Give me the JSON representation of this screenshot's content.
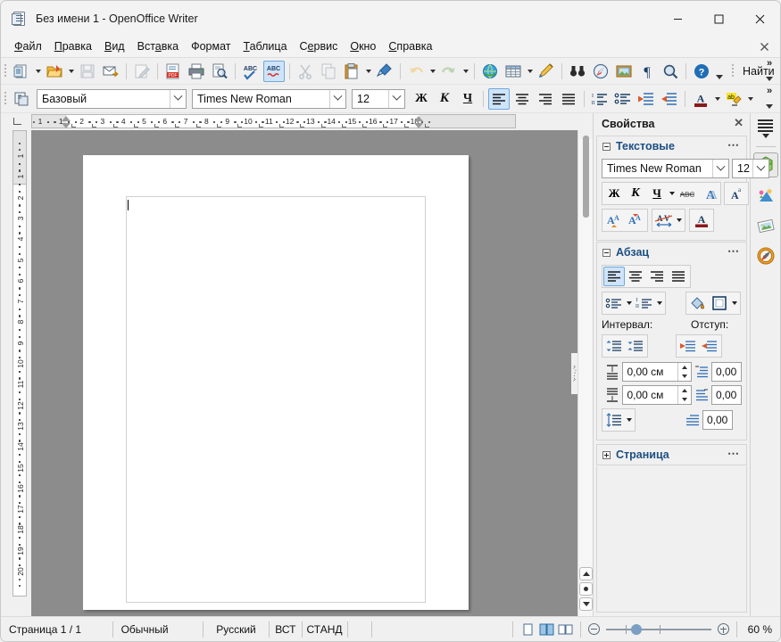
{
  "window": {
    "title": "Без имени 1 - OpenOffice Writer",
    "icon": "writer-document-icon",
    "controls": {
      "minimize": "minimize-icon",
      "maximize": "maximize-icon",
      "close": "close-icon"
    }
  },
  "menubar": {
    "items": [
      {
        "label": "Файл",
        "accel": "Ф"
      },
      {
        "label": "Правка",
        "accel": "П"
      },
      {
        "label": "Вид",
        "accel": "В"
      },
      {
        "label": "Вставка",
        "accel": "а"
      },
      {
        "label": "Формат",
        "accel": ""
      },
      {
        "label": "Таблица",
        "accel": "Т"
      },
      {
        "label": "Сервис",
        "accel": "е"
      },
      {
        "label": "Окно",
        "accel": "О"
      },
      {
        "label": "Справка",
        "accel": "С"
      }
    ],
    "close_document": "close-document-icon"
  },
  "standard_toolbar": {
    "buttons": [
      {
        "name": "new-document",
        "icon": "new-doc-icon",
        "dropdown": true,
        "enabled": true
      },
      {
        "name": "open-document",
        "icon": "open-folder-icon",
        "dropdown": true,
        "enabled": true
      },
      {
        "name": "save-document",
        "icon": "save-floppy-icon",
        "dropdown": false,
        "enabled": false
      },
      {
        "name": "email-document",
        "icon": "email-envelope-icon",
        "dropdown": false,
        "enabled": true
      },
      {
        "name": "edit-file",
        "icon": "edit-pencil-page-icon",
        "dropdown": false,
        "enabled": false
      },
      {
        "name": "export-pdf",
        "icon": "pdf-export-icon",
        "dropdown": false,
        "enabled": true
      },
      {
        "name": "print-document",
        "icon": "printer-icon",
        "dropdown": false,
        "enabled": true
      },
      {
        "name": "print-preview",
        "icon": "print-preview-magnifier-icon",
        "dropdown": false,
        "enabled": true
      },
      {
        "name": "spelling-check",
        "icon": "abc-spellcheck-icon",
        "dropdown": false,
        "enabled": true
      },
      {
        "name": "autospellcheck",
        "icon": "abc-autospell-icon",
        "dropdown": false,
        "enabled": true,
        "active": true
      },
      {
        "name": "cut",
        "icon": "scissors-icon",
        "dropdown": false,
        "enabled": false
      },
      {
        "name": "copy",
        "icon": "copy-pages-icon",
        "dropdown": false,
        "enabled": false
      },
      {
        "name": "paste",
        "icon": "clipboard-paste-icon",
        "dropdown": true,
        "enabled": true
      },
      {
        "name": "clone-formatting",
        "icon": "paintbrush-icon",
        "dropdown": false,
        "enabled": true
      },
      {
        "name": "undo",
        "icon": "undo-arrow-icon",
        "dropdown": true,
        "enabled": false
      },
      {
        "name": "redo",
        "icon": "redo-arrow-icon",
        "dropdown": true,
        "enabled": false
      },
      {
        "name": "hyperlink",
        "icon": "globe-hyperlink-icon",
        "dropdown": false,
        "enabled": true
      },
      {
        "name": "insert-table",
        "icon": "table-grid-icon",
        "dropdown": true,
        "enabled": true
      },
      {
        "name": "show-draw-functions",
        "icon": "draw-pencil-icon",
        "dropdown": false,
        "enabled": true
      },
      {
        "name": "find-and-replace",
        "icon": "binoculars-icon",
        "dropdown": false,
        "enabled": true
      },
      {
        "name": "navigator",
        "icon": "compass-navigator-icon",
        "dropdown": false,
        "enabled": true
      },
      {
        "name": "gallery",
        "icon": "gallery-picture-icon",
        "dropdown": false,
        "enabled": true
      },
      {
        "name": "formatting-marks",
        "icon": "pilcrow-icon",
        "dropdown": false,
        "enabled": true
      },
      {
        "name": "zoom",
        "icon": "magnifier-zoom-icon",
        "dropdown": false,
        "enabled": true
      },
      {
        "name": "help",
        "icon": "help-question-icon",
        "dropdown": false,
        "enabled": true
      }
    ],
    "find_label": "Найти",
    "overflow": "toolbar-overflow-icon"
  },
  "format_toolbar": {
    "styles_icon": "apply-style-icon",
    "paragraph_style": "Базовый",
    "font_name": "Times New Roman",
    "font_size": "12",
    "bold_label": "Ж",
    "italic_label": "К",
    "underline_label": "Ч",
    "buttons": [
      {
        "name": "align-left",
        "icon": "align-left-icon",
        "active": true
      },
      {
        "name": "align-center",
        "icon": "align-center-icon",
        "active": false
      },
      {
        "name": "align-right",
        "icon": "align-right-icon",
        "active": false
      },
      {
        "name": "align-justified",
        "icon": "align-justify-icon",
        "active": false
      },
      {
        "name": "ordered-list",
        "icon": "numbered-list-icon",
        "active": false
      },
      {
        "name": "unordered-list",
        "icon": "bullet-list-icon",
        "active": false
      },
      {
        "name": "decrease-indent",
        "icon": "decrease-indent-icon",
        "active": false
      },
      {
        "name": "increase-indent",
        "icon": "increase-indent-icon",
        "active": false
      },
      {
        "name": "font-color",
        "icon": "font-color-a-icon",
        "active": false
      },
      {
        "name": "highlighting",
        "icon": "highlight-marker-icon",
        "active": false
      }
    ],
    "overflow": "toolbar-overflow-icon"
  },
  "rulers": {
    "horizontal": {
      "unit": "cm",
      "labels": [
        "1",
        "1",
        "2",
        "3",
        "4",
        "5",
        "6",
        "7",
        "8",
        "9",
        "10",
        "11",
        "12",
        "13",
        "14",
        "15",
        "16",
        "17",
        "18"
      ]
    },
    "vertical": {
      "unit": "cm",
      "labels": [
        "1",
        "1",
        "2",
        "3",
        "4",
        "5",
        "6",
        "7",
        "8",
        "9",
        "10",
        "11",
        "12",
        "13",
        "14",
        "15",
        "16",
        "17",
        "18",
        "19",
        "20"
      ]
    }
  },
  "document": {
    "page_background": "#ffffff",
    "canvas_background": "#8c8c8c",
    "text_frame_border": "#d0d0d0",
    "content": ""
  },
  "scrollbar": {
    "previous_page": "previous-page-icon",
    "navigation": "navigation-dot-icon",
    "next_page": "next-page-icon"
  },
  "sidebar": {
    "title": "Свойства",
    "close_icon": "close-icon",
    "panels": [
      {
        "id": "character",
        "title": "Текстовые",
        "expanded": true,
        "more_icon": "more-options-icon",
        "font_name": "Times New Roman",
        "font_size": "12",
        "bold_label": "Ж",
        "italic_label": "К",
        "underline_label": "Ч",
        "buttons": [
          {
            "name": "bold",
            "icon": "bold-icon"
          },
          {
            "name": "italic",
            "icon": "italic-icon"
          },
          {
            "name": "underline",
            "icon": "underline-icon"
          },
          {
            "name": "strikethrough",
            "icon": "strikethrough-abc-icon"
          },
          {
            "name": "shadow",
            "icon": "shadow-a-icon"
          },
          {
            "name": "superscript",
            "icon": "superscript-icon"
          },
          {
            "name": "increase-font-size",
            "icon": "grow-font-icon"
          },
          {
            "name": "decrease-font-size",
            "icon": "shrink-font-icon"
          },
          {
            "name": "character-spacing",
            "icon": "character-spacing-av-icon"
          },
          {
            "name": "font-color",
            "icon": "font-color-a-icon"
          }
        ]
      },
      {
        "id": "paragraph",
        "title": "Абзац",
        "expanded": true,
        "more_icon": "more-options-icon",
        "spacing_label": "Интервал:",
        "indent_label": "Отступ:",
        "align_buttons": [
          {
            "name": "align-left",
            "icon": "align-left-icon",
            "active": true
          },
          {
            "name": "align-center",
            "icon": "align-center-icon",
            "active": false
          },
          {
            "name": "align-right",
            "icon": "align-right-icon",
            "active": false
          },
          {
            "name": "align-justified",
            "icon": "align-justify-icon",
            "active": false
          }
        ],
        "list_buttons": [
          {
            "name": "bullet-list",
            "icon": "bullet-list-icon"
          },
          {
            "name": "numbered-list",
            "icon": "numbered-list-icon"
          }
        ],
        "background_buttons": [
          {
            "name": "paragraph-background-color",
            "icon": "paint-can-icon"
          },
          {
            "name": "paragraph-borders",
            "icon": "border-square-icon"
          }
        ],
        "spacing_buttons": [
          {
            "name": "increase-paragraph-spacing",
            "icon": "increase-spacing-icon"
          },
          {
            "name": "decrease-paragraph-spacing",
            "icon": "decrease-spacing-icon"
          }
        ],
        "indent_buttons": [
          {
            "name": "decrease-indent",
            "icon": "decrease-indent-icon"
          },
          {
            "name": "increase-indent",
            "icon": "increase-indent-icon"
          }
        ],
        "above_spacing_value": "0,00 см",
        "below_spacing_value": "0,00 см",
        "indent_before_value": "0,00",
        "indent_after_value": "0,00",
        "indent_first_line_value": "0,00",
        "line_spacing_icon": "line-spacing-icon"
      },
      {
        "id": "page",
        "title": "Страница",
        "expanded": false,
        "more_icon": "more-options-icon"
      }
    ],
    "tabs": [
      {
        "name": "sidebar-settings-menu",
        "icon": "sidebar-menu-icon",
        "active": false
      },
      {
        "name": "tab-properties",
        "icon": "properties-cube-icon",
        "active": true
      },
      {
        "name": "tab-gallery",
        "icon": "gallery-star-icon",
        "active": false
      },
      {
        "name": "tab-styles",
        "icon": "styles-picture-icon",
        "active": false
      },
      {
        "name": "tab-navigator",
        "icon": "navigator-compass-icon",
        "active": false
      }
    ]
  },
  "statusbar": {
    "page_info": "Страница  1 / 1",
    "page_style": "Обычный",
    "language": "Русский",
    "insert_mode": "ВСТ",
    "selection_mode": "СТАНД",
    "digital_signature": "",
    "section_info": "",
    "view_buttons": [
      {
        "name": "single-page-view",
        "icon": "single-page-icon",
        "active": false
      },
      {
        "name": "multi-page-view",
        "icon": "multi-page-icon",
        "active": true
      },
      {
        "name": "book-view",
        "icon": "book-view-icon",
        "active": false
      }
    ],
    "zoom_out_icon": "zoom-out-icon",
    "zoom_in_icon": "zoom-in-icon",
    "zoom_value": "60 %"
  },
  "colors": {
    "accent": "#1d4f82",
    "selection": "#cfe4f9",
    "canvas": "#8c8c8c",
    "chrome": "#f0f0f0"
  }
}
